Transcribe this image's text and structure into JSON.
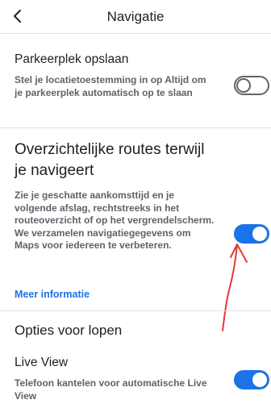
{
  "header": {
    "title": "Navigatie",
    "back_icon": "chevron-left-icon"
  },
  "parking": {
    "title": "Parkeerplek opslaan",
    "description": "Stel je locatietoestemming in op Altijd om je parkeerplek automatisch op te slaan",
    "toggle_on": false
  },
  "routes": {
    "title": "Overzichtelijke routes terwijl je navigeert",
    "description": "Zie je geschatte aankomsttijd en je volgende afslag, rechtstreeks in het routeoverzicht of op het vergrendelscherm. We verzamelen navigatiegegevens om Maps voor iedereen te verbeteren.",
    "link": "Meer informatie",
    "toggle_on": true
  },
  "walking": {
    "section_title": "Opties voor lopen"
  },
  "live_view": {
    "title": "Live View",
    "description": "Telefoon kantelen voor automatische Live View",
    "toggle_on": true
  },
  "colors": {
    "accent": "#1a73e8",
    "annotation": "#e53935",
    "text_secondary": "#5f6368"
  },
  "annotation_icon": "hand-drawn-arrow-icon"
}
